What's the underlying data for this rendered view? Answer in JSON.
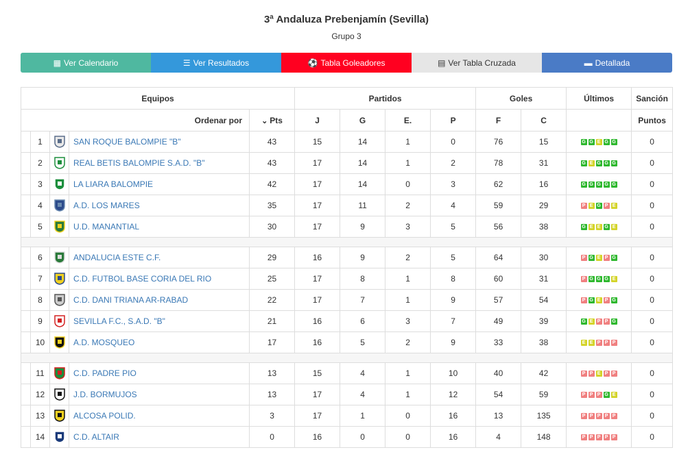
{
  "header": {
    "title": "3ª Andaluza Prebenjamín (Sevilla)",
    "subtitle": "Grupo 3"
  },
  "nav": [
    {
      "label": "Ver Calendario",
      "icon": "calendar-icon",
      "color": "#4fb8a0"
    },
    {
      "label": "Ver Resultados",
      "icon": "list-icon",
      "color": "#3498db"
    },
    {
      "label": "Tabla Goleadores",
      "icon": "soccer-ball-icon",
      "color": "#ff0020"
    },
    {
      "label": "Ver Tabla Cruzada",
      "icon": "calculator-icon",
      "color": "#e6e6e6"
    },
    {
      "label": "Detallada",
      "icon": "table-icon",
      "color": "#4a7bc6"
    }
  ],
  "table": {
    "group_headers": {
      "equipos": "Equipos",
      "partidos": "Partidos",
      "goles": "Goles",
      "ultimos": "Últimos",
      "sancion": "Sanción"
    },
    "sub_headers": {
      "ordenar": "Ordenar por",
      "pts": "Pts",
      "j": "J",
      "g": "G",
      "e": "E.",
      "p": "P",
      "f": "F",
      "c": "C",
      "puntos": "Puntos"
    },
    "rows": [
      {
        "pos": "1",
        "team": "SAN ROQUE BALOMPIE \"B\"",
        "pts": "43",
        "j": "15",
        "g": "14",
        "e": "1",
        "p": "0",
        "f": "76",
        "c": "15",
        "last": [
          "G",
          "G",
          "E",
          "G",
          "G"
        ],
        "sancion": "0"
      },
      {
        "pos": "2",
        "team": "REAL BETIS BALOMPIE S.A.D. \"B\"",
        "pts": "43",
        "j": "17",
        "g": "14",
        "e": "1",
        "p": "2",
        "f": "78",
        "c": "31",
        "last": [
          "G",
          "E",
          "G",
          "G",
          "G"
        ],
        "sancion": "0"
      },
      {
        "pos": "3",
        "team": "LA LIARA BALOMPIE",
        "pts": "42",
        "j": "17",
        "g": "14",
        "e": "0",
        "p": "3",
        "f": "62",
        "c": "16",
        "last": [
          "G",
          "G",
          "G",
          "G",
          "G"
        ],
        "sancion": "0"
      },
      {
        "pos": "4",
        "team": "A.D. LOS MARES",
        "pts": "35",
        "j": "17",
        "g": "11",
        "e": "2",
        "p": "4",
        "f": "59",
        "c": "29",
        "last": [
          "P",
          "E",
          "G",
          "P",
          "E"
        ],
        "sancion": "0"
      },
      {
        "pos": "5",
        "team": "U.D. MANANTIAL",
        "pts": "30",
        "j": "17",
        "g": "9",
        "e": "3",
        "p": "5",
        "f": "56",
        "c": "38",
        "last": [
          "G",
          "E",
          "E",
          "G",
          "E"
        ],
        "sancion": "0"
      },
      {
        "pos": "6",
        "team": "ANDALUCIA ESTE C.F.",
        "pts": "29",
        "j": "16",
        "g": "9",
        "e": "2",
        "p": "5",
        "f": "64",
        "c": "30",
        "last": [
          "P",
          "G",
          "E",
          "P",
          "G"
        ],
        "sancion": "0"
      },
      {
        "pos": "7",
        "team": "C.D. FUTBOL BASE CORIA DEL RIO",
        "pts": "25",
        "j": "17",
        "g": "8",
        "e": "1",
        "p": "8",
        "f": "60",
        "c": "31",
        "last": [
          "P",
          "G",
          "G",
          "G",
          "E"
        ],
        "sancion": "0"
      },
      {
        "pos": "8",
        "team": "C.D. DANI TRIANA AR-RABAD",
        "pts": "22",
        "j": "17",
        "g": "7",
        "e": "1",
        "p": "9",
        "f": "57",
        "c": "54",
        "last": [
          "P",
          "G",
          "E",
          "P",
          "G"
        ],
        "sancion": "0"
      },
      {
        "pos": "9",
        "team": "SEVILLA F.C., S.A.D. \"B\"",
        "pts": "21",
        "j": "16",
        "g": "6",
        "e": "3",
        "p": "7",
        "f": "49",
        "c": "39",
        "last": [
          "G",
          "E",
          "P",
          "P",
          "G"
        ],
        "sancion": "0"
      },
      {
        "pos": "10",
        "team": "A.D. MOSQUEO",
        "pts": "17",
        "j": "16",
        "g": "5",
        "e": "2",
        "p": "9",
        "f": "33",
        "c": "38",
        "last": [
          "E",
          "E",
          "P",
          "P",
          "P"
        ],
        "sancion": "0"
      },
      {
        "pos": "11",
        "team": "C.D. PADRE PIO",
        "pts": "13",
        "j": "15",
        "g": "4",
        "e": "1",
        "p": "10",
        "f": "40",
        "c": "42",
        "last": [
          "P",
          "P",
          "E",
          "P",
          "P"
        ],
        "sancion": "0"
      },
      {
        "pos": "12",
        "team": "J.D. BORMUJOS",
        "pts": "13",
        "j": "17",
        "g": "4",
        "e": "1",
        "p": "12",
        "f": "54",
        "c": "59",
        "last": [
          "P",
          "P",
          "P",
          "G",
          "E"
        ],
        "sancion": "0"
      },
      {
        "pos": "13",
        "team": "ALCOSA POLID.",
        "pts": "3",
        "j": "17",
        "g": "1",
        "e": "0",
        "p": "16",
        "f": "13",
        "c": "135",
        "last": [
          "P",
          "P",
          "P",
          "P",
          "P"
        ],
        "sancion": "0"
      },
      {
        "pos": "14",
        "team": "C.D. ALTAIR",
        "pts": "0",
        "j": "16",
        "g": "0",
        "e": "0",
        "p": "16",
        "f": "4",
        "c": "148",
        "last": [
          "P",
          "P",
          "P",
          "P",
          "P"
        ],
        "sancion": "0"
      }
    ],
    "result_colors": {
      "G": "#2eb82e",
      "E": "#d4d42a",
      "P": "#f08080"
    }
  }
}
